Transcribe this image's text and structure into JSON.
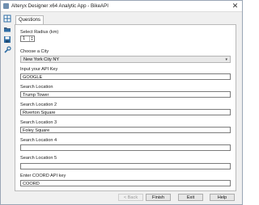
{
  "window": {
    "title": "Alteryx Designer x64 Analytic App - BikeAPI",
    "close_glyph": "✕"
  },
  "sidebar": {
    "icons": [
      "grid-icon",
      "folder-icon",
      "save-icon",
      "wrench-icon"
    ]
  },
  "tabs": [
    {
      "label": "Questions",
      "active": true
    }
  ],
  "form": {
    "radius": {
      "label": "Select Radius (km)",
      "value": "1"
    },
    "city": {
      "label": "Choose a City",
      "value": "New York City NY"
    },
    "api_key": {
      "label": "Input your API Key",
      "value": "GOOGLE"
    },
    "search1": {
      "label": "Search Location",
      "value": "Trump Tower"
    },
    "search2": {
      "label": "Search Location 2",
      "value": "Riverton Square"
    },
    "search3": {
      "label": "Search Location 3",
      "value": "Foley Square"
    },
    "search4": {
      "label": "Search Location 4",
      "value": ""
    },
    "search5": {
      "label": "Search Location 5",
      "value": ""
    },
    "coord_key": {
      "label": "Enter COORD API key",
      "value": "COORD"
    }
  },
  "buttons": {
    "back": "< Back",
    "finish": "Finish",
    "exit": "Exit",
    "help": "Help"
  },
  "colors": {
    "accent_icon": "#2e6da4",
    "window_border": "#9aa6b5"
  }
}
